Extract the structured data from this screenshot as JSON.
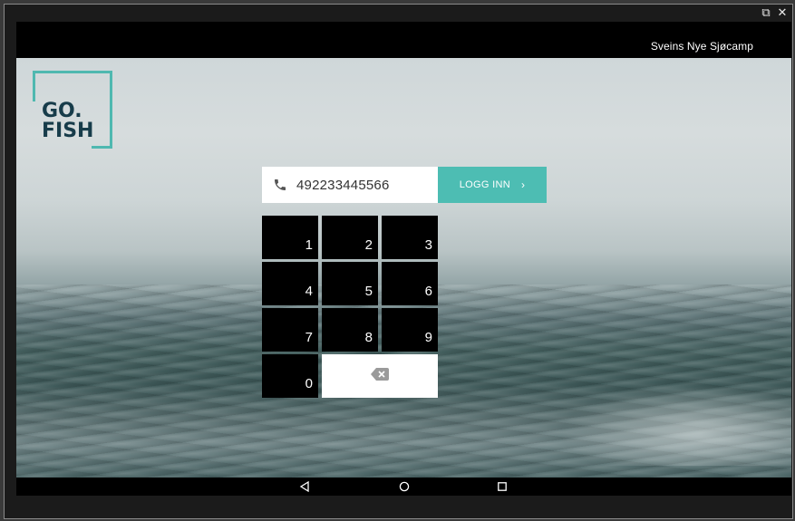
{
  "window": {
    "controls": [
      {
        "name": "popout-icon",
        "glyph": "⧉"
      },
      {
        "name": "close-icon",
        "glyph": "✕"
      }
    ]
  },
  "status_bar": {
    "title": "Sveins Nye Sjøcamp"
  },
  "logo": {
    "line1": "GO.",
    "line2": "FISH",
    "accent_color": "#4fb8b0",
    "text_color": "#173c4a"
  },
  "login": {
    "phone_icon": "phone-icon",
    "phone_value": "492233445566",
    "button_label": "LOGG INN",
    "button_chevron": "›",
    "button_color": "#4dbdb3"
  },
  "keypad": {
    "keys": [
      "1",
      "2",
      "3",
      "4",
      "5",
      "6",
      "7",
      "8",
      "9",
      "0"
    ],
    "backspace_icon": "backspace-icon"
  },
  "nav_bar": {
    "buttons": [
      "back-icon",
      "home-icon",
      "recents-icon"
    ]
  }
}
